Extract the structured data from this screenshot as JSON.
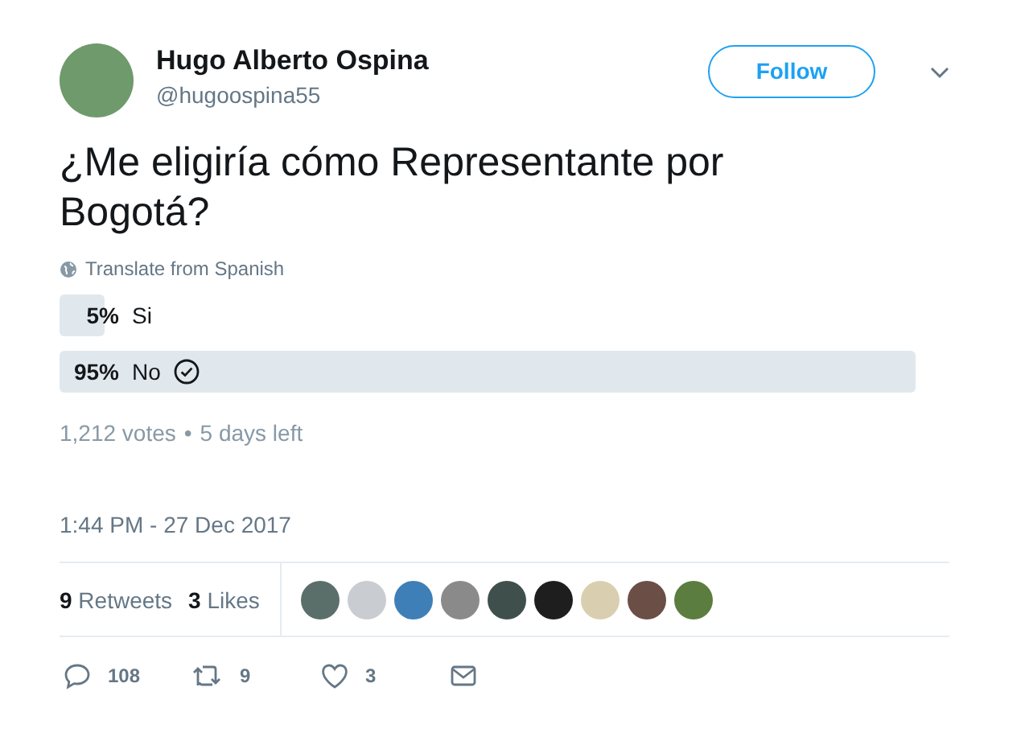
{
  "author": {
    "name": "Hugo Alberto Ospina",
    "handle": "@hugoospina55"
  },
  "follow_button": "Follow",
  "tweet_text": "¿Me eligiría cómo Representante por Bogotá?",
  "translate_link": "Translate from Spanish",
  "poll": {
    "options": [
      {
        "percent": "5%",
        "label": "Si",
        "level": 0.05,
        "selected": false
      },
      {
        "percent": "95%",
        "label": "No",
        "level": 0.95,
        "selected": true
      }
    ],
    "votes": "1,212 votes",
    "separator": "•",
    "time_left": "5 days left"
  },
  "timestamp": "1:44 PM - 27 Dec 2017",
  "stats": [
    {
      "count": "9",
      "label": "Retweets"
    },
    {
      "count": "3",
      "label": "Likes"
    }
  ],
  "liker_avatars": [
    {
      "kind": "photo"
    },
    {
      "kind": "photo"
    },
    {
      "kind": "photo"
    },
    {
      "kind": "photo"
    },
    {
      "kind": "photo"
    },
    {
      "kind": "photo"
    },
    {
      "kind": "photo"
    },
    {
      "kind": "photo"
    },
    {
      "kind": "photo"
    }
  ],
  "actions": [
    {
      "kind": "reply",
      "count": "108"
    },
    {
      "kind": "retweet",
      "count": "9"
    },
    {
      "kind": "like",
      "count": "3"
    },
    {
      "kind": "message"
    }
  ]
}
